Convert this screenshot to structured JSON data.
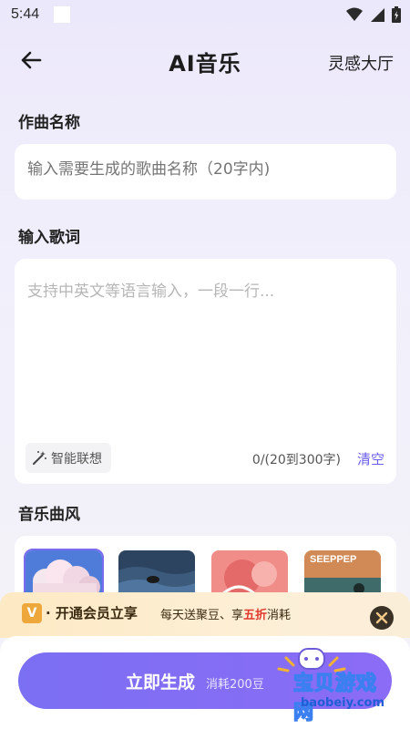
{
  "status_bar": {
    "time": "5:44"
  },
  "app_bar": {
    "title": "AI音乐",
    "right_link": "灵感大厅"
  },
  "song_name": {
    "label": "作曲名称",
    "placeholder": "输入需要生成的歌曲名称（20字内)"
  },
  "lyrics": {
    "label": "输入歌词",
    "placeholder": "支持中英文等语言输入，一段一行...",
    "assist_label": "智能联想",
    "counter": "0/(20到300字)",
    "clear_label": "清空"
  },
  "music_style": {
    "label": "音乐曲风",
    "thumbnails": [
      {
        "icon": "cloud-cover"
      },
      {
        "icon": "ocean-cover"
      },
      {
        "icon": "coral-cover"
      },
      {
        "icon": "seeppy-cover",
        "text": "SEEPPEP"
      }
    ]
  },
  "vip_banner": {
    "badge": "V",
    "main": "· 开通会员立享",
    "sub_prefix": "每天送聚豆、享",
    "sub_highlight": "五折",
    "sub_suffix": "消耗"
  },
  "generate": {
    "label": "立即生成",
    "cost": "消耗200豆"
  },
  "watermark": {
    "text": "宝贝游戏网",
    "url": "baobeiy.com"
  },
  "colors": {
    "accent": "#7b6ff3",
    "highlight": "#e0392e",
    "banner": "#fde9c3"
  }
}
